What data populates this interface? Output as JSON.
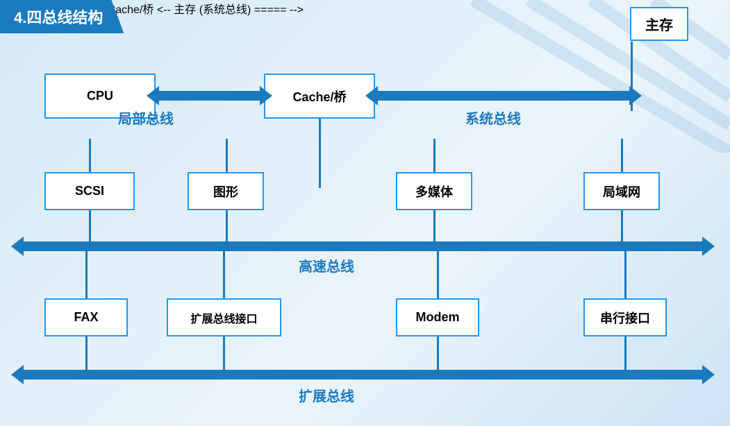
{
  "title": "4.四总线结构",
  "main_memory": "主存",
  "boxes": {
    "cpu": "CPU",
    "cache": "Cache/桥",
    "scsi": "SCSI",
    "graph": "图形",
    "multimedia": "多媒体",
    "lan": "局域网",
    "fax": "FAX",
    "expand": "扩展总线接口",
    "modem": "Modem",
    "serial": "串行接口"
  },
  "labels": {
    "local_bus": "局部总线",
    "system_bus": "系统总线",
    "high_speed_bus": "高速总线",
    "expand_bus": "扩展总线"
  }
}
